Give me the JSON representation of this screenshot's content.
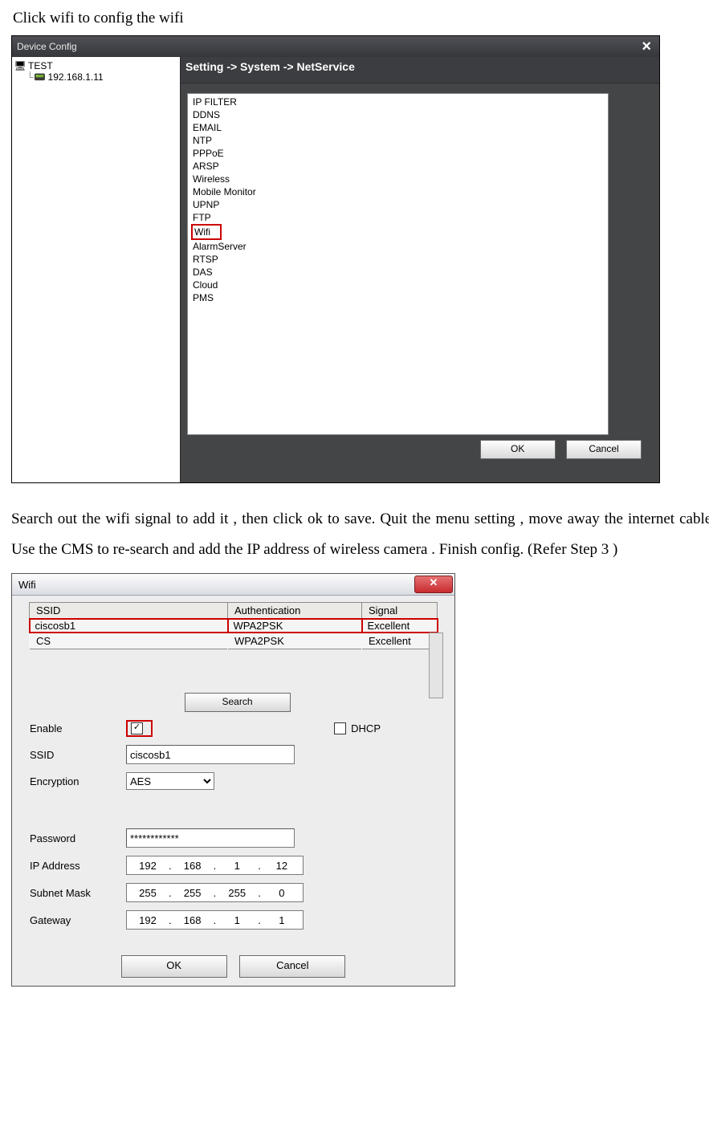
{
  "intro1": "Click wifi to config the wifi",
  "fig1": {
    "title": "Device Config",
    "tree_root": "TEST",
    "tree_ip": "192.168.1.11",
    "breadcrumb": "Setting -> System -> NetService",
    "services": [
      "IP FILTER",
      "DDNS",
      "EMAIL",
      "NTP",
      "PPPoE",
      "ARSP",
      "Wireless",
      "Mobile Monitor",
      "UPNP",
      "FTP",
      "Wifi",
      "AlarmServer",
      "RTSP",
      "DAS",
      "Cloud",
      "PMS"
    ],
    "highlight": "Wifi",
    "ok": "OK",
    "cancel": "Cancel"
  },
  "intro2": "Search out the wifi signal to add it , then click ok to save. Quit the menu setting , move away the internet cable . Use the CMS to re-search and add the IP address of wireless camera . Finish config. (Refer Step 3 )",
  "fig2": {
    "title": "Wifi",
    "cols": {
      "ssid": "SSID",
      "auth": "Authentication",
      "sig": "Signal"
    },
    "rows": [
      {
        "ssid": "ciscosb1",
        "auth": "WPA2PSK",
        "sig": "Excellent",
        "sel": true
      },
      {
        "ssid": "CS",
        "auth": "WPA2PSK",
        "sig": "Excellent",
        "sel": false
      }
    ],
    "search": "Search",
    "labels": {
      "enable": "Enable",
      "dhcp": "DHCP",
      "ssid": "SSID",
      "enc": "Encryption",
      "pw": "Password",
      "ip": "IP Address",
      "mask": "Subnet Mask",
      "gw": "Gateway"
    },
    "values": {
      "enable_checked": true,
      "dhcp_checked": false,
      "ssid": "ciscosb1",
      "enc": "AES",
      "pw": "************",
      "ip": [
        "192",
        "168",
        "1",
        "12"
      ],
      "mask": [
        "255",
        "255",
        "255",
        "0"
      ],
      "gw": [
        "192",
        "168",
        "1",
        "1"
      ]
    },
    "ok": "OK",
    "cancel": "Cancel"
  }
}
